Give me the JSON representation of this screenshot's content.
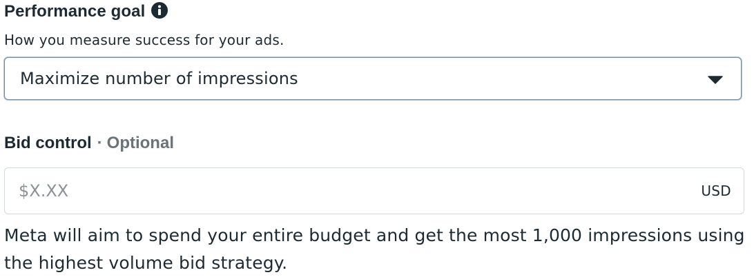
{
  "performance_goal": {
    "title": "Performance goal",
    "info_icon": "info-circle-icon",
    "subtitle": "How you measure success for your ads.",
    "selected_value": "Maximize number of impressions",
    "dropdown_icon": "caret-down-icon"
  },
  "bid_control": {
    "label": "Bid control",
    "separator": "·",
    "optional": "Optional",
    "placeholder": "$X.XX",
    "value": "",
    "currency": "USD"
  },
  "help_text": "Meta will aim to spend your entire budget and get the most 1,000 impressions using the highest volume bid strategy.",
  "colors": {
    "text": "#1c2b33",
    "muted": "#6a7378",
    "focus_ring": "#a9c8e6",
    "border": "#d3d8dc"
  }
}
